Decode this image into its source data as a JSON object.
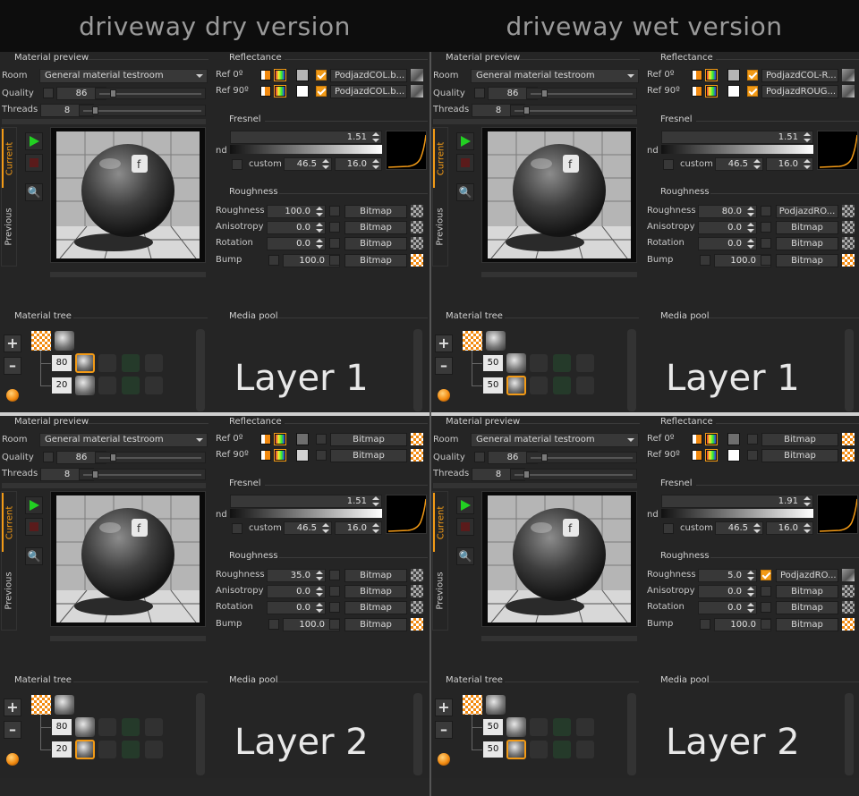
{
  "headers": {
    "dry": "driveway dry version",
    "wet": "driveway wet version"
  },
  "labels": {
    "material_preview": "Material preview",
    "reflectance": "Reflectance",
    "fresnel": "Fresnel",
    "roughness_section": "Roughness",
    "material_tree": "Material tree",
    "media_pool": "Media pool",
    "room": "Room",
    "quality": "Quality",
    "threads": "Threads",
    "ref0": "Ref 0º",
    "ref90": "Ref 90º",
    "nd": "nd",
    "custom": "custom",
    "roughness": "Roughness",
    "anisotropy": "Anisotropy",
    "rotation": "Rotation",
    "bump": "Bump",
    "current": "Current",
    "previous": "Previous"
  },
  "panels": [
    {
      "room": "General material testroom",
      "quality": "86",
      "threads": "8",
      "ref0_map": "PodjazdCOL.b...",
      "ref90_map": "PodjazdCOL.b...",
      "ref0_color": "#b4b4b4",
      "ref90_color": "#ffffff",
      "nd": "1.51",
      "custom_a": "46.5",
      "custom_b": "16.0",
      "roughness": "100.0",
      "anisotropy": "0.0",
      "rotation": "0.0",
      "bump": "100.0",
      "roughness_map": "Bitmap",
      "anisotropy_map": "Bitmap",
      "rotation_map": "Bitmap",
      "bump_map": "Bitmap",
      "tree_top": "80",
      "tree_bottom": "20",
      "layer": "Layer 1"
    },
    {
      "room": "General material testroom",
      "quality": "86",
      "threads": "8",
      "ref0_map": "PodjazdCOL-R...",
      "ref90_map": "PodjazdROUG...",
      "ref0_color": "#b4b4b4",
      "ref90_color": "#ffffff",
      "nd": "1.51",
      "custom_a": "46.5",
      "custom_b": "16.0",
      "roughness": "80.0",
      "anisotropy": "0.0",
      "rotation": "0.0",
      "bump": "100.0",
      "roughness_map": "PodjazdRO...",
      "anisotropy_map": "Bitmap",
      "rotation_map": "Bitmap",
      "bump_map": "Bitmap",
      "tree_top": "50",
      "tree_bottom": "50",
      "layer": "Layer 1"
    },
    {
      "room": "General material testroom",
      "quality": "86",
      "threads": "8",
      "ref0_map": "Bitmap",
      "ref90_map": "Bitmap",
      "ref0_color": "#6e6e6e",
      "ref90_color": "#d2d2d2",
      "nd": "1.51",
      "custom_a": "46.5",
      "custom_b": "16.0",
      "roughness": "35.0",
      "anisotropy": "0.0",
      "rotation": "0.0",
      "bump": "100.0",
      "roughness_map": "Bitmap",
      "anisotropy_map": "Bitmap",
      "rotation_map": "Bitmap",
      "bump_map": "Bitmap",
      "tree_top": "80",
      "tree_bottom": "20",
      "layer": "Layer 2"
    },
    {
      "room": "General material testroom",
      "quality": "86",
      "threads": "8",
      "ref0_map": "Bitmap",
      "ref90_map": "Bitmap",
      "ref0_color": "#6e6e6e",
      "ref90_color": "#ffffff",
      "nd": "1.91",
      "custom_a": "46.5",
      "custom_b": "16.0",
      "roughness": "5.0",
      "anisotropy": "0.0",
      "rotation": "0.0",
      "bump": "100.0",
      "roughness_map": "PodjazdRO...",
      "anisotropy_map": "Bitmap",
      "rotation_map": "Bitmap",
      "bump_map": "Bitmap",
      "tree_top": "50",
      "tree_bottom": "50",
      "layer": "Layer 2"
    }
  ],
  "colors": {
    "accent": "#f29a16",
    "play": "#22d022",
    "background": "#252525",
    "header": "#0d0d0d"
  }
}
